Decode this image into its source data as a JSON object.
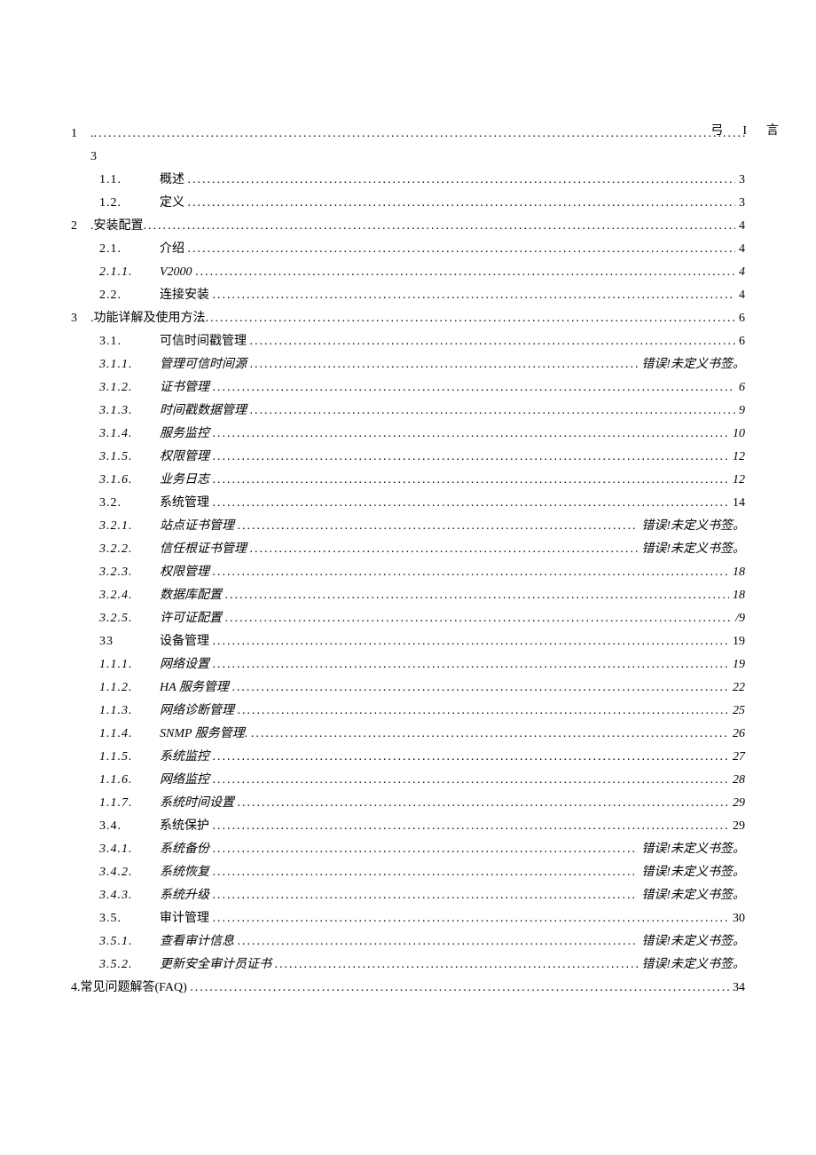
{
  "special_right_label": "弓I言",
  "line1_num": "1",
  "line1_prefix": ".",
  "line3_text": "3",
  "entries": [
    {
      "num": "1.1.",
      "title": "概述",
      "page": "3",
      "italic": false,
      "level": 2
    },
    {
      "num": "1.2.",
      "title": "定义",
      "page": "3",
      "italic": false,
      "level": 2
    }
  ],
  "sec2_num": "2",
  "sec2_title": ".安装配置",
  "sec2_page": "4",
  "entries2": [
    {
      "num": "2.1.",
      "title": "介绍",
      "page": "4",
      "italic": false
    },
    {
      "num": "2.1.1.",
      "title": "V2000",
      "page": "4",
      "italic": true
    },
    {
      "num": "2.2.",
      "title": "连接安装",
      "page": "4",
      "italic": false
    }
  ],
  "sec3_num": "3",
  "sec3_title": ".功能详解及使用方法",
  "sec3_page": "6",
  "entries3": [
    {
      "num": "3.1.",
      "title": "可信时间戳管理",
      "page": "6",
      "italic": false
    },
    {
      "num": "3.1.1.",
      "title": "管理可信时间源",
      "page": "错误!未定义书签。",
      "italic": true
    },
    {
      "num": "3.1.2.",
      "title": "证书管理",
      "page": "6",
      "italic": true
    },
    {
      "num": "3.1.3.",
      "title": "时间戳数据管理",
      "page": "9",
      "italic": true
    },
    {
      "num": "3.1.4.",
      "title": "服务监控",
      "page": "10",
      "italic": true
    },
    {
      "num": "3.1.5.",
      "title": "权限管理",
      "page": "12",
      "italic": true
    },
    {
      "num": "3.1.6.",
      "title": "业务日志",
      "page": "12",
      "italic": true
    },
    {
      "num": "3.2.",
      "title": "系统管理",
      "page": "14",
      "italic": false
    },
    {
      "num": "3.2.1.",
      "title": "站点证书管理",
      "page": "错误!未定义书签。",
      "italic": true
    },
    {
      "num": "3.2.2.",
      "title": "信任根证书管理",
      "page": "错误!未定义书签。",
      "italic": true
    },
    {
      "num": "3.2.3.",
      "title": "权限管理",
      "page": "18",
      "italic": true
    },
    {
      "num": "3.2.4.",
      "title": "数据库配置",
      "page": "18",
      "italic": true
    },
    {
      "num": "3.2.5.",
      "title": "许可证配置",
      "page": "/9",
      "italic": true
    },
    {
      "num": "33",
      "title": "设备管理",
      "page": "19",
      "italic": false
    },
    {
      "num": "1.1.1.",
      "title": "网络设置",
      "page": "19",
      "italic": true
    },
    {
      "num": "1.1.2.",
      "title": "HA 服务管理",
      "page": "22",
      "italic": true
    },
    {
      "num": "1.1.3.",
      "title": "网络诊断管理",
      "page": "25",
      "italic": true
    },
    {
      "num": "1.1.4.",
      "title": "SNMP 服务管理.",
      "page": "26",
      "italic": true
    },
    {
      "num": "1.1.5.",
      "title": "系统监控",
      "page": "27",
      "italic": true
    },
    {
      "num": "1.1.6.",
      "title": "网络监控",
      "page": "28",
      "italic": true
    },
    {
      "num": "1.1.7.",
      "title": "系统时间设置",
      "page": "29",
      "italic": true
    },
    {
      "num": "3.4.",
      "title": "系统保护",
      "page": "29",
      "italic": false
    },
    {
      "num": "3.4.1.",
      "title": "系统备份",
      "page": "错误!未定义书签。",
      "italic": true
    },
    {
      "num": "3.4.2.",
      "title": "系统恢复",
      "page": "错误!未定义书签。",
      "italic": true
    },
    {
      "num": "3.4.3.",
      "title": "系统升级",
      "page": "错误!未定义书签。",
      "italic": true
    },
    {
      "num": "3.5.",
      "title": "审计管理",
      "page": "30",
      "italic": false
    },
    {
      "num": "3.5.1.",
      "title": "查看审计信息",
      "page": "错误!未定义书签。",
      "italic": true
    },
    {
      "num": "3.5.2.",
      "title": "更新安全审计员证书",
      "page": "错误!未定义书签。",
      "italic": true
    }
  ],
  "sec4_title": "4.常见问题解答(FAQ)",
  "sec4_page": "34",
  "dot_fill": "........................................................................................................................................................................................................"
}
